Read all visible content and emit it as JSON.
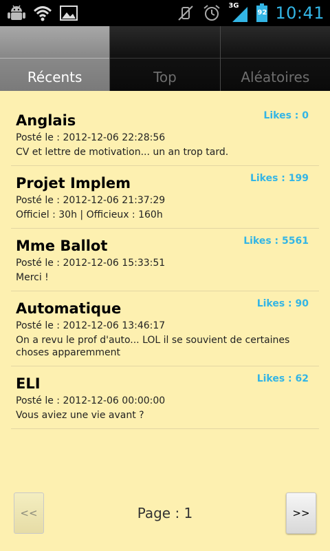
{
  "statusbar": {
    "clock": "10:41",
    "network_type": "3G",
    "battery_level": "92",
    "left_icons": [
      "android-debug-icon",
      "wifi-icon",
      "image-icon"
    ],
    "right_icons": [
      "mute-icon",
      "alarm-icon",
      "signal-icon",
      "battery-icon"
    ]
  },
  "tabs": [
    {
      "label": "Récents",
      "active": true
    },
    {
      "label": "Top",
      "active": false
    },
    {
      "label": "Aléatoires",
      "active": false
    }
  ],
  "items": [
    {
      "title": "Anglais",
      "date": "Posté le : 2012-12-06 22:28:56",
      "body": "CV et lettre de motivation... un an trop tard.",
      "likes": "Likes : 0"
    },
    {
      "title": "Projet Implem",
      "date": "Posté le : 2012-12-06 21:37:29",
      "body": "Officiel : 30h | Officieux : 160h",
      "likes": "Likes : 199"
    },
    {
      "title": "Mme Ballot",
      "date": "Posté le : 2012-12-06 15:33:51",
      "body": "Merci !",
      "likes": "Likes : 5561"
    },
    {
      "title": "Automatique",
      "date": "Posté le : 2012-12-06 13:46:17",
      "body": "On a revu le prof d'auto... LOL il se souvient de certaines choses apparemment",
      "likes": "Likes : 90"
    },
    {
      "title": "ELI",
      "date": "Posté le : 2012-12-06 00:00:00",
      "body": "Vous aviez une vie avant ?",
      "likes": "Likes : 62"
    }
  ],
  "pager": {
    "prev_label": "<<",
    "next_label": ">>",
    "page_label": "Page : 1"
  },
  "colors": {
    "background": "#fdf0b0",
    "accent": "#33b5e5"
  }
}
